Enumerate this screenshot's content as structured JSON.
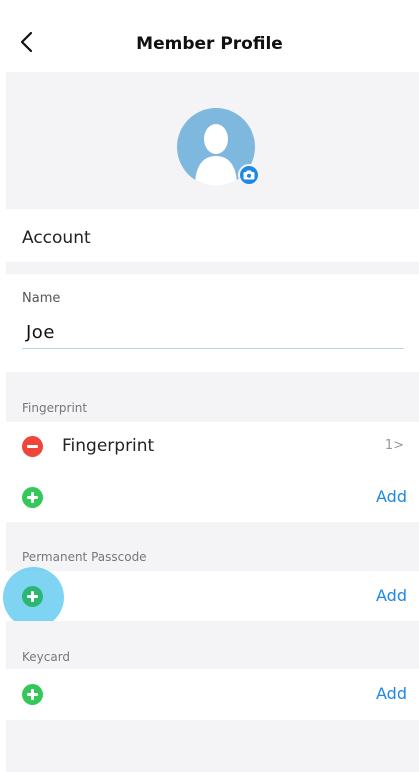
{
  "header": {
    "title": "Member Profile",
    "back_icon": "chevron-left-icon"
  },
  "avatar": {
    "icon": "user-avatar-placeholder",
    "badge_icon": "camera-icon",
    "colors": {
      "avatar_bg": "#7fb8de",
      "badge": "#1e88e5"
    }
  },
  "account": {
    "label": "Account"
  },
  "name": {
    "label": "Name",
    "value": "Joe"
  },
  "fingerprint": {
    "section_label": "Fingerprint",
    "item_label": "Fingerprint",
    "item_count": "1>",
    "add_label": "Add"
  },
  "passcode": {
    "section_label": "Permanent Passcode",
    "add_label": "Add"
  },
  "keycard": {
    "section_label": "Keycard",
    "add_label": "Add"
  },
  "colors": {
    "accent": "#1e88e5",
    "remove": "#f0453a",
    "add": "#34c759",
    "section_bg": "#f4f4f6"
  }
}
